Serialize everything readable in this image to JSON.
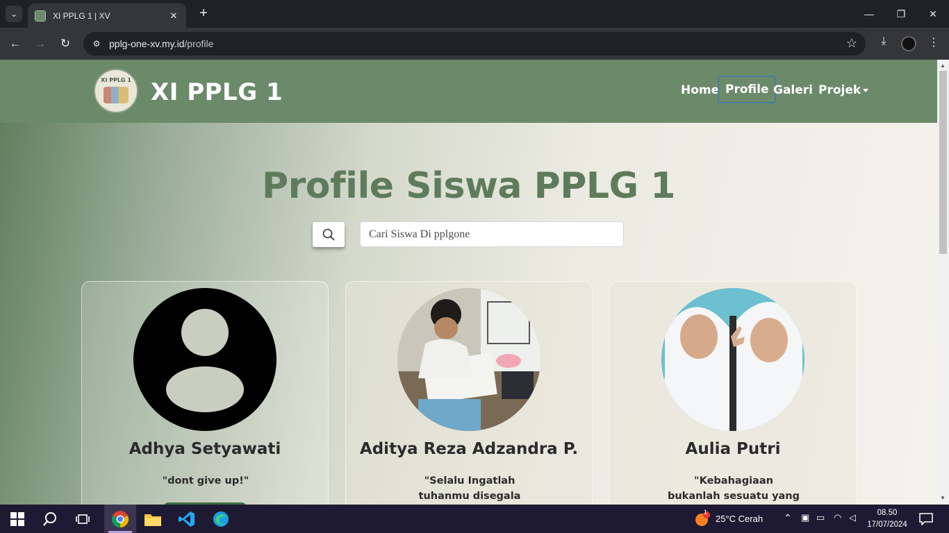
{
  "browser": {
    "tab_title": "XI PPLG 1 | XV",
    "url_host": "pplg-one-xv.my.id",
    "url_path": "/profile",
    "new_tab_glyph": "+",
    "close_glyph": "✕"
  },
  "site": {
    "logo_text": "XI PPLG 1",
    "brand": "XI PPLG 1",
    "nav": {
      "home": "Home",
      "profile": "Profile",
      "galeri": "Galeri",
      "projek": "Projek"
    },
    "heading": "Profile Siswa PPLG 1",
    "search_placeholder": "Cari Siswa Di pplgone"
  },
  "students": [
    {
      "name": "Adhya Setyawati",
      "quote_line1": "\"dont give up!\"",
      "quote_line2": "",
      "photo": "default-avatar-icon"
    },
    {
      "name": "Aditya Reza Adzandra P.",
      "quote_line1": "\"Selalu Ingatlah",
      "quote_line2": "tuhanmu disegala",
      "photo": "student-photo"
    },
    {
      "name": "Aulia Putri",
      "quote_line1": "\"Kebahagiaan",
      "quote_line2": "bukanlah sesuatu yang",
      "photo": "student-photo"
    }
  ],
  "taskbar": {
    "weather": "25°C  Cerah",
    "weather_badge": "1",
    "time": "08.50",
    "date": "17/07/2024"
  },
  "colors": {
    "accent": "#6b8a6a",
    "heading": "#5e7c5c",
    "card_button": "#3f6b45"
  }
}
